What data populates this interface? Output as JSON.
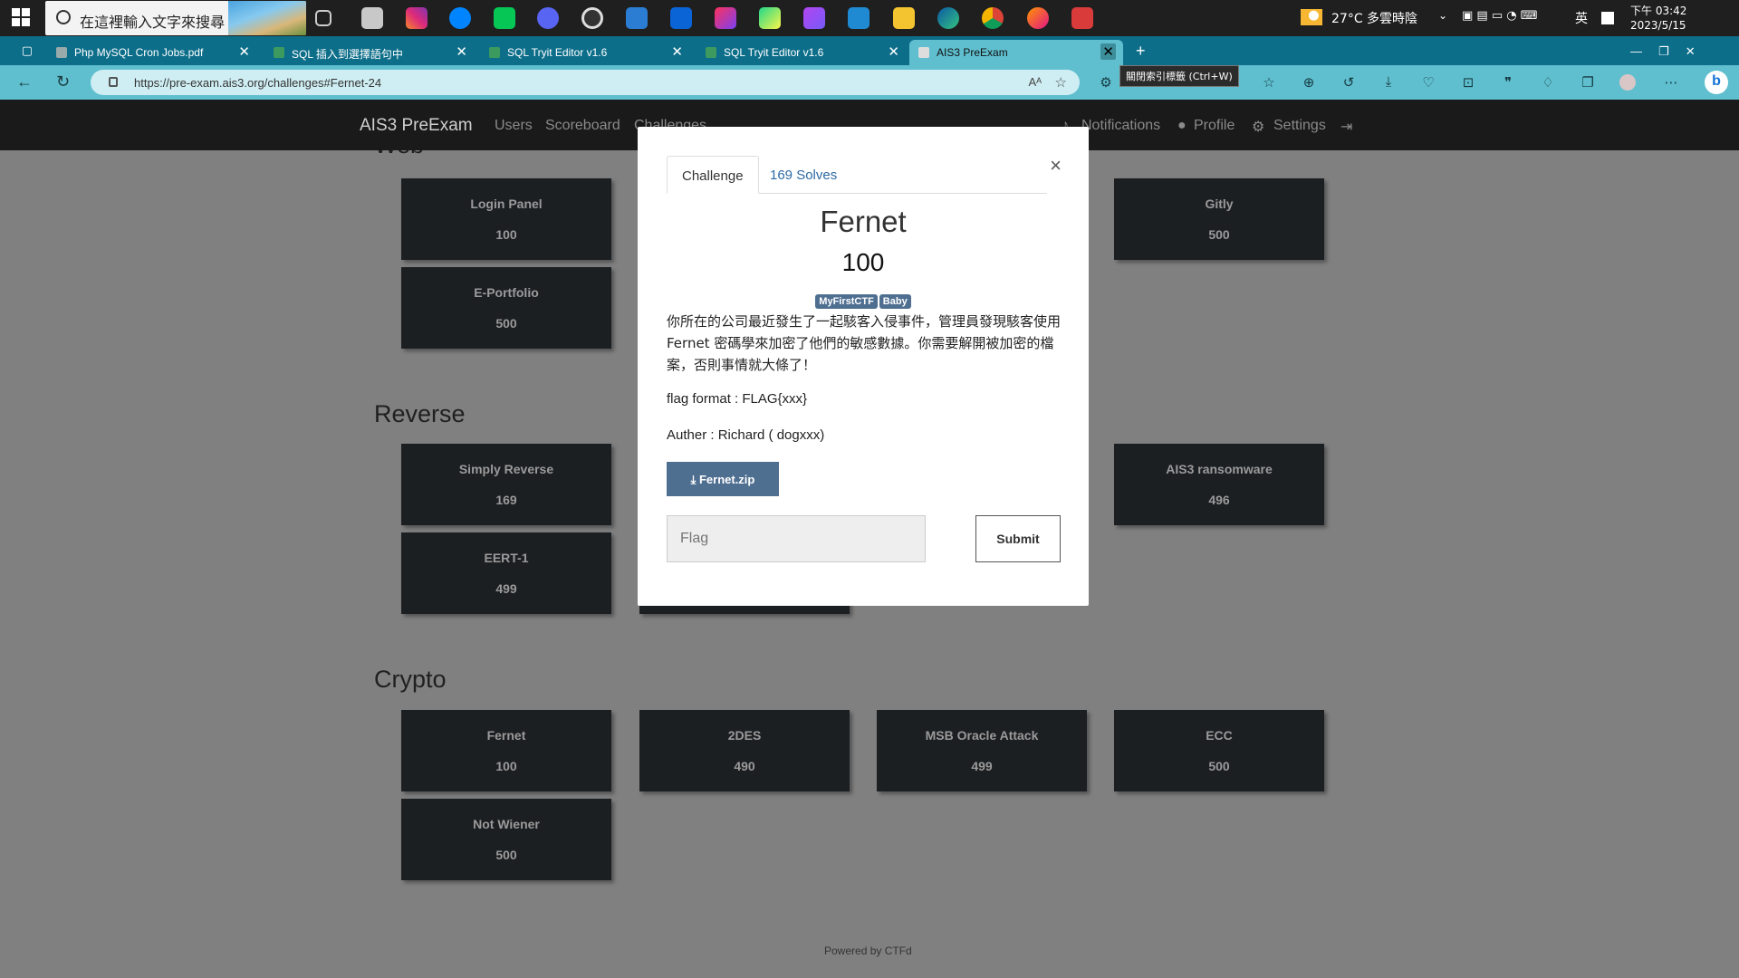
{
  "taskbar": {
    "search_placeholder": "在這裡輸入文字來搜尋",
    "weather": "27°C 多雲時陰",
    "ime": "英",
    "time": "下午 03:42",
    "date": "2023/5/15"
  },
  "tabs": [
    {
      "label": "Php MySQL Cron Jobs.pdf"
    },
    {
      "label": "SQL 插入到選擇語句中"
    },
    {
      "label": "SQL Tryit Editor v1.6"
    },
    {
      "label": "SQL Tryit Editor v1.6"
    },
    {
      "label": "AIS3 PreExam"
    }
  ],
  "address": {
    "url": "https://pre-exam.ais3.org/challenges#Fernet-24",
    "tooltip": "關閉索引標籤 (Ctrl+W)"
  },
  "ctf_nav": {
    "brand": "AIS3 PreExam",
    "links": [
      "Users",
      "Scoreboard",
      "Challenges"
    ],
    "right": [
      "Notifications",
      "Profile",
      "Settings"
    ]
  },
  "sections": [
    {
      "title": "Web",
      "cards": [
        {
          "name": "Login Panel",
          "value": "100"
        },
        {
          "name": "Gitly",
          "value": "500"
        },
        {
          "name": "E-Portfolio",
          "value": "500"
        }
      ]
    },
    {
      "title": "Reverse",
      "cards": [
        {
          "name": "Simply Reverse",
          "value": "169"
        },
        {
          "name": "AIS3 ransomware",
          "value": "496"
        },
        {
          "name": "EERT-1",
          "value": "499"
        }
      ]
    },
    {
      "title": "Crypto",
      "cards": [
        {
          "name": "Fernet",
          "value": "100"
        },
        {
          "name": "2DES",
          "value": "490"
        },
        {
          "name": "MSB Oracle Attack",
          "value": "499"
        },
        {
          "name": "ECC",
          "value": "500"
        },
        {
          "name": "Not Wiener",
          "value": "500"
        }
      ]
    }
  ],
  "footer": "Powered by CTFd",
  "modal": {
    "tab_challenge": "Challenge",
    "tab_solves": "169 Solves",
    "title": "Fernet",
    "value": "100",
    "tags": [
      "MyFirstCTF",
      "Baby"
    ],
    "description": "你所在的公司最近發生了一起駭客入侵事件，管理員發現駭客使用 Fernet 密碼學來加密了他們的敏感數據。你需要解開被加密的檔案，否則事情就大條了！",
    "format": "flag format : FLAG{xxx}",
    "author": "Auther : Richard ( dogxxx)",
    "download": "Fernet.zip",
    "flag_placeholder": "Flag",
    "submit": "Submit"
  }
}
